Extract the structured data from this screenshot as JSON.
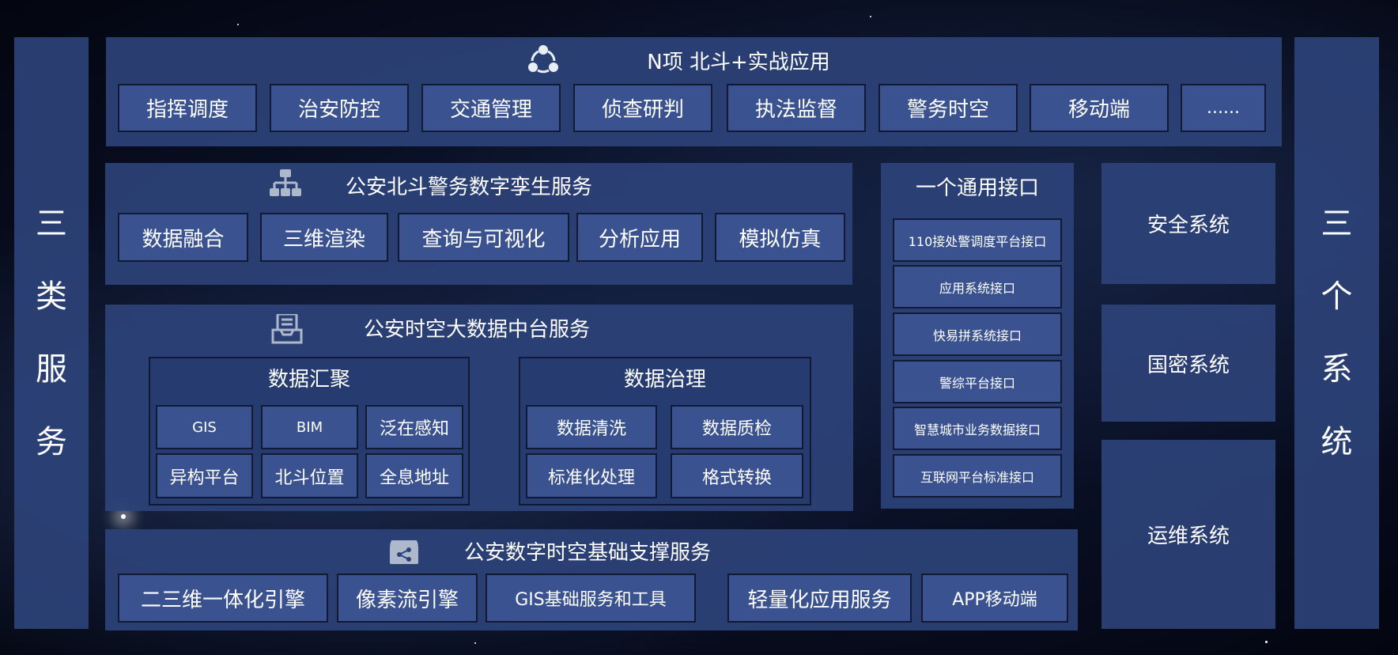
{
  "left_pillar": {
    "chars": [
      "三",
      "类",
      "服",
      "务"
    ]
  },
  "right_pillar": {
    "chars": [
      "三",
      "个",
      "系",
      "统"
    ]
  },
  "top_layer": {
    "title": "N项  北斗+实战应用",
    "icon": "network-nodes-icon",
    "items": [
      "指挥调度",
      "治安防控",
      "交通管理",
      "侦查研判",
      "执法监督",
      "警务时空",
      "移动端",
      "......"
    ]
  },
  "twin_layer": {
    "title": "公安北斗警务数字孪生服务",
    "icon": "org-chart-icon",
    "items": [
      "数据融合",
      "三维渲染",
      "查询与可视化",
      "分析应用",
      "模拟仿真"
    ]
  },
  "bigdata_layer": {
    "title": "公安时空大数据中台服务",
    "icon": "inbox-tray-icon",
    "aggregation": {
      "title": "数据汇聚",
      "items": [
        "GIS",
        "BIM",
        "泛在感知",
        "异构平台",
        "北斗位置",
        "全息地址"
      ]
    },
    "governance": {
      "title": "数据治理",
      "items": [
        "数据清洗",
        "数据质检",
        "标准化处理",
        "格式转换"
      ]
    }
  },
  "foundation_layer": {
    "title": "公安数字时空基础支撑服务",
    "icon": "share-box-icon",
    "items": [
      "二三维一体化引擎",
      "像素流引擎",
      "GIS基础服务和工具",
      "轻量化应用服务",
      "APP移动端"
    ]
  },
  "interface_panel": {
    "title": "一个通用接口",
    "items": [
      "110接处警调度平台接口",
      "应用系统接口",
      "快易拼系统接口",
      "警综平台接口",
      "智慧城市业务数据接口",
      "互联网平台标准接口"
    ]
  },
  "systems": [
    "安全系统",
    "国密系统",
    "运维系统"
  ]
}
